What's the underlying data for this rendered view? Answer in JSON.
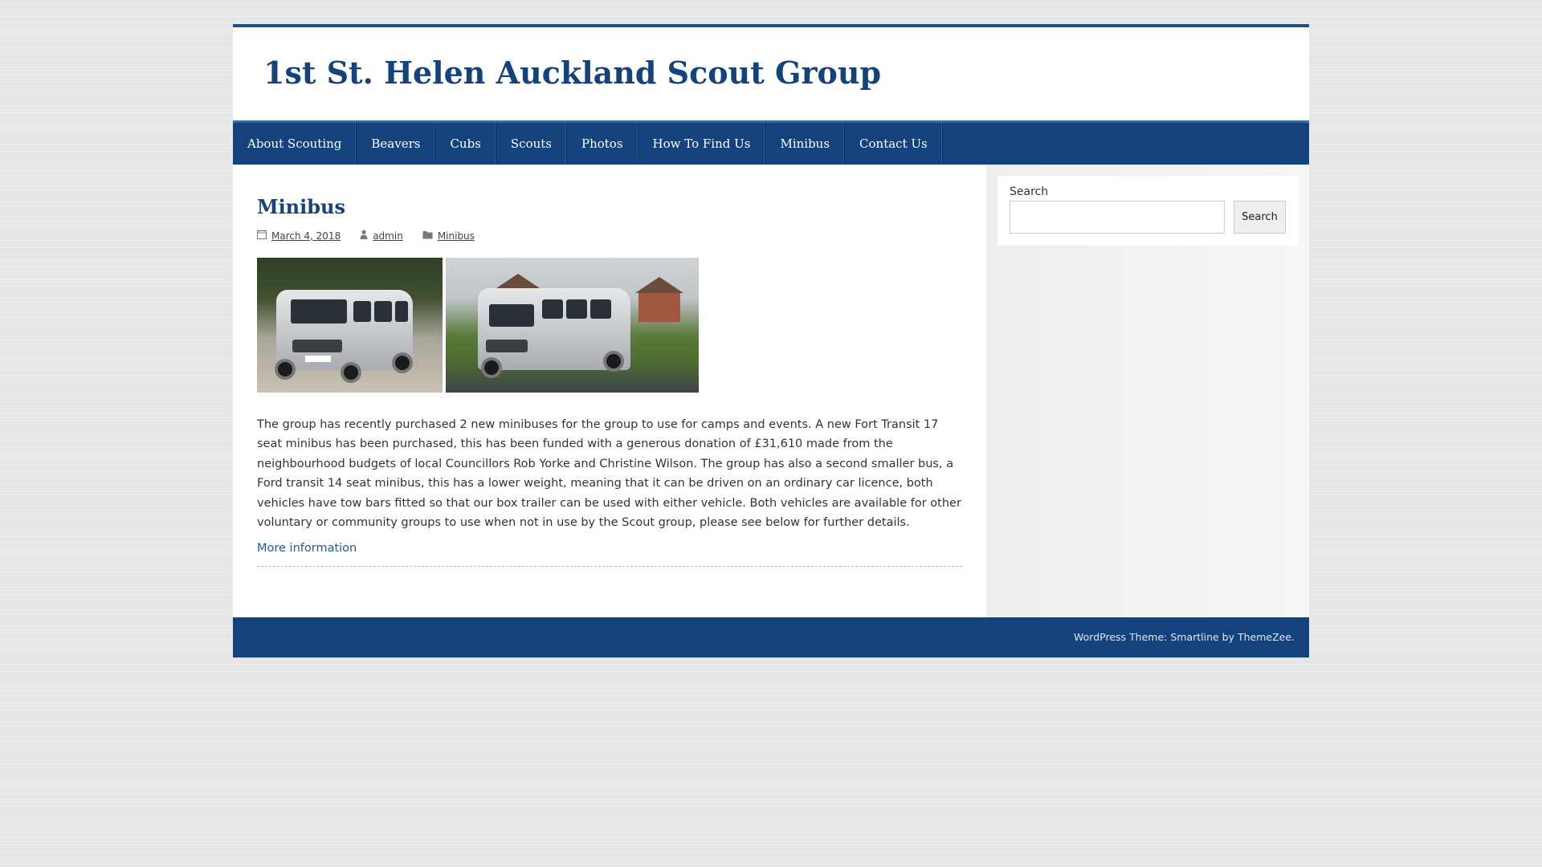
{
  "site": {
    "title": "1st St. Helen Auckland Scout Group"
  },
  "nav": {
    "items": [
      {
        "label": "About Scouting"
      },
      {
        "label": "Beavers"
      },
      {
        "label": "Cubs"
      },
      {
        "label": "Scouts"
      },
      {
        "label": "Photos"
      },
      {
        "label": "How To Find Us"
      },
      {
        "label": "Minibus"
      },
      {
        "label": "Contact Us"
      }
    ]
  },
  "post": {
    "title": "Minibus",
    "date": "March 4, 2018",
    "author": "admin",
    "category": "Minibus",
    "body": "The group has recently purchased 2 new minibuses for the group to use for camps and events.  A new Fort Transit 17 seat minibus has been purchased, this has been funded with a generous donation of £31,610 made from the neighbourhood budgets of local Councillors Rob Yorke and Christine Wilson.  The group has also a second smaller bus, a Ford transit 14 seat minibus, this has a lower weight, meaning that it can be driven on an ordinary car licence, both vehicles have tow bars fitted so that our box trailer can be used with either vehicle.  Both vehicles are available for other voluntary or community groups to use when not in use by the Scout group, please see below for further details.",
    "more_link": "More information"
  },
  "sidebar": {
    "search_label": "Search",
    "search_value": "",
    "search_button": "Search"
  },
  "footer": {
    "text": "WordPress Theme: Smartline by ThemeZee."
  },
  "colors": {
    "brand_blue": "#13427c",
    "title_blue": "#14427a",
    "link_blue": "#1d5a9e"
  },
  "icons": {
    "date": "calendar-icon",
    "author": "user-icon",
    "category": "folder-icon"
  }
}
